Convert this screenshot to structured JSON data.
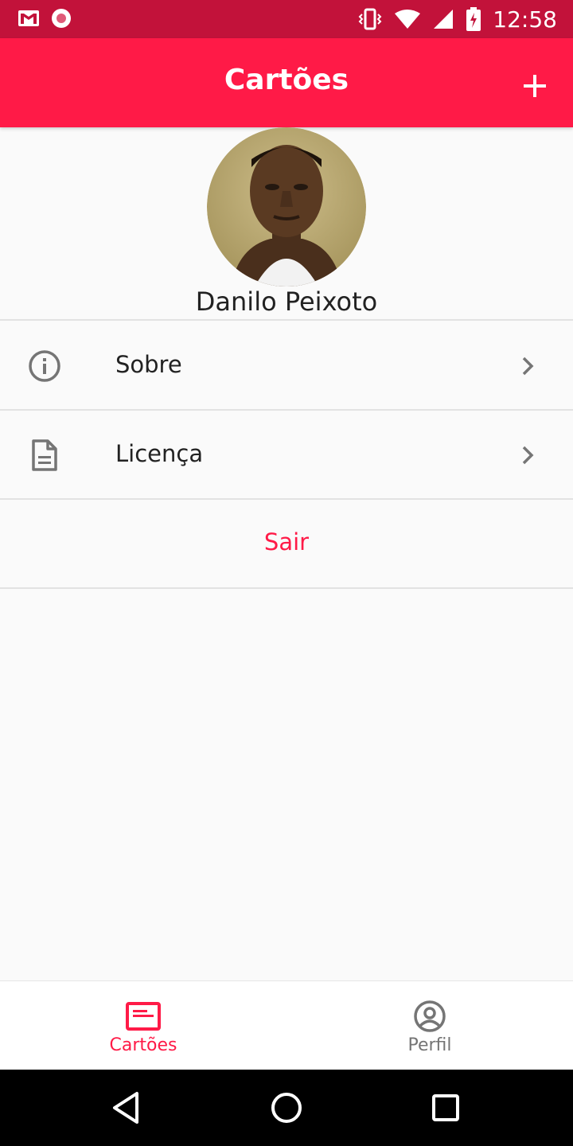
{
  "status_bar": {
    "time": "12:58",
    "left_icons": [
      "gmail-icon",
      "record-icon"
    ],
    "right_icons": [
      "vibrate-icon",
      "wifi-icon",
      "signal-icon",
      "battery-charging-icon"
    ]
  },
  "app_bar": {
    "title": "Cartões",
    "action_icon": "plus-icon"
  },
  "profile": {
    "name": "Danilo Peixoto"
  },
  "menu": {
    "items": [
      {
        "label": "Sobre",
        "icon": "info-icon"
      },
      {
        "label": "Licença",
        "icon": "document-icon"
      }
    ],
    "logout_label": "Sair"
  },
  "bottom_nav": {
    "tabs": [
      {
        "label": "Cartões",
        "icon": "card-icon",
        "active": true
      },
      {
        "label": "Perfil",
        "icon": "account-circle-icon",
        "active": false
      }
    ]
  },
  "colors": {
    "primary": "#ff1a47",
    "status_bar": "#c2123a",
    "inactive": "#757575",
    "background": "#fafafa"
  }
}
